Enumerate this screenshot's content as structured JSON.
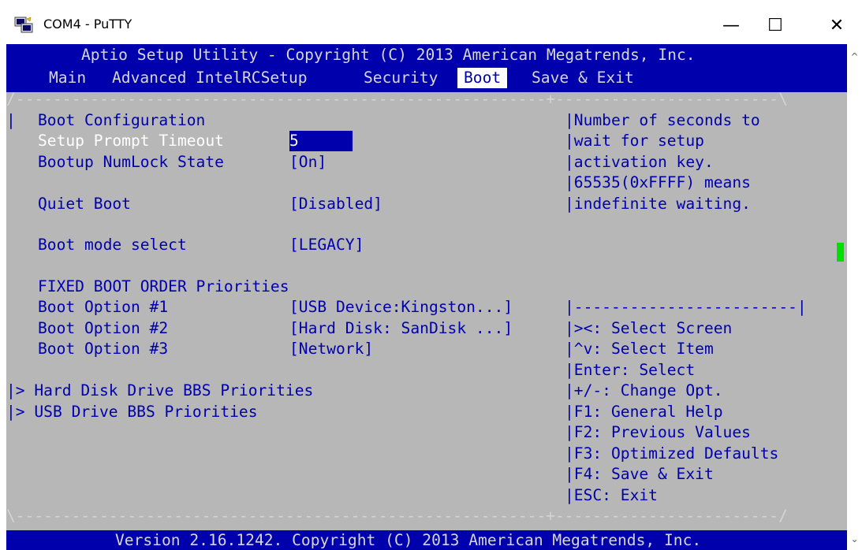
{
  "window": {
    "title": "COM4 - PuTTY",
    "minimize": "—",
    "maximize": "☐",
    "close": "✕"
  },
  "header": {
    "title": "Aptio Setup Utility - Copyright (C) 2013 American Megatrends, Inc.",
    "tabs": [
      "Main",
      "Advanced",
      "IntelRCSetup",
      "Security",
      "Boot",
      "Save & Exit"
    ],
    "active_tab": "Boot"
  },
  "borders": {
    "top": "/---------------------------------------------------------+------------------------\\",
    "mid_help": "|------------------------|",
    "bottom": "\\---------------------------------------------------------+------------------------/"
  },
  "boot": {
    "section_title": "Boot Configuration",
    "setup_prompt_timeout": {
      "label": "Setup Prompt Timeout",
      "value": "5"
    },
    "bootup_numlock": {
      "label": "Bootup NumLock State",
      "value": "[On]"
    },
    "quiet_boot": {
      "label": "Quiet Boot",
      "value": "[Disabled]"
    },
    "boot_mode": {
      "label": "Boot mode select",
      "value": "[LEGACY]"
    },
    "fixed_order_title": "FIXED BOOT ORDER Priorities",
    "options": [
      {
        "label": "Boot Option #1",
        "value": "[USB Device:Kingston...]"
      },
      {
        "label": "Boot Option #2",
        "value": "[Hard Disk: SanDisk ...]"
      },
      {
        "label": "Boot Option #3",
        "value": "[Network]"
      }
    ],
    "submenus": [
      "> Hard Disk Drive BBS Priorities",
      "> USB Drive BBS Priorities"
    ]
  },
  "help": {
    "description": [
      "Number of seconds to",
      "wait for setup",
      "activation key.",
      "65535(0xFFFF) means",
      "indefinite waiting."
    ],
    "keys": [
      "><: Select Screen",
      "^v: Select Item",
      "Enter: Select",
      "+/-: Change Opt.",
      "F1: General Help",
      "F2: Previous Values",
      "F3: Optimized Defaults",
      "F4: Save & Exit",
      "ESC: Exit"
    ]
  },
  "footer": "Version 2.16.1242. Copyright (C) 2013 American Megatrends, Inc.",
  "colors": {
    "terminal_bg": "#b7b7b7",
    "bios_blue": "#0000ac",
    "highlight_white": "#ffffff",
    "scroll_marker": "#00e000"
  },
  "icons": {
    "app": "putty-icon",
    "scroll_up": "chevron-up-icon",
    "scroll_down": "chevron-down-icon"
  }
}
